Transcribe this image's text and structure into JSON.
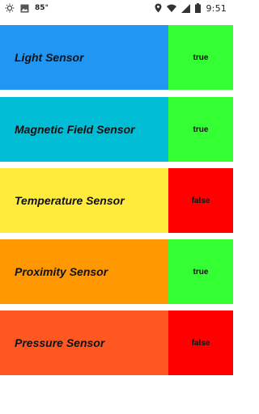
{
  "status_bar": {
    "temperature": "85°",
    "time": "9:51"
  },
  "colors": {
    "true_bg": "#33ff33",
    "false_bg": "#ff0000"
  },
  "sensors": [
    {
      "name": "Light Sensor",
      "value": "true",
      "color": "#2196f3"
    },
    {
      "name": "Magnetic Field Sensor",
      "value": "true",
      "color": "#00bcd4"
    },
    {
      "name": "Temperature Sensor",
      "value": "false",
      "color": "#ffeb3b"
    },
    {
      "name": "Proximity Sensor",
      "value": "true",
      "color": "#ff9800"
    },
    {
      "name": "Pressure Sensor",
      "value": "false",
      "color": "#ff5722"
    }
  ]
}
